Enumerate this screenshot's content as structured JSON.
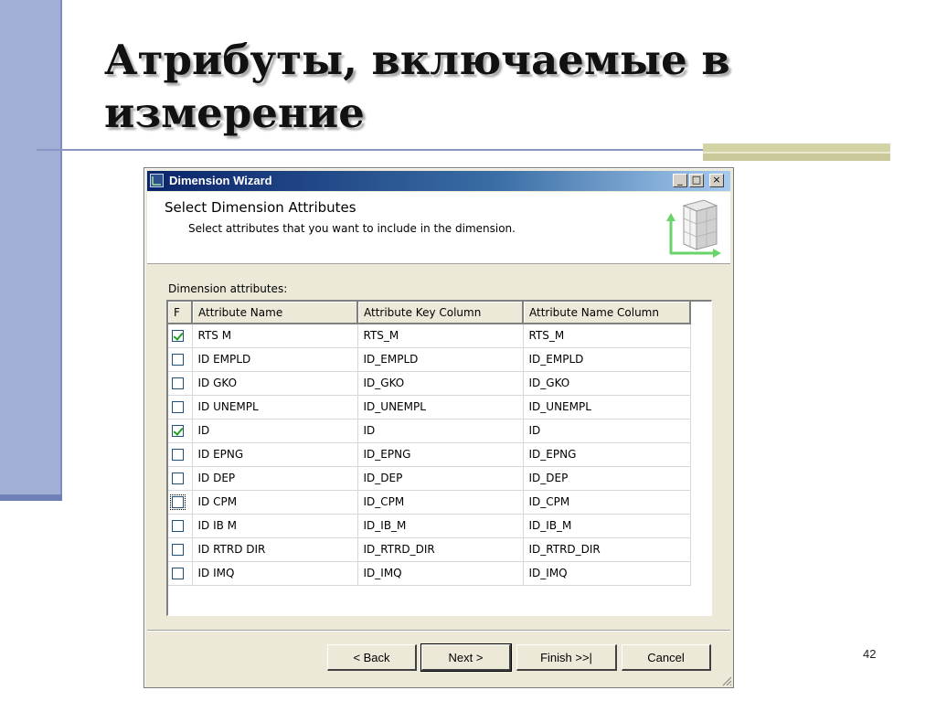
{
  "slide": {
    "title_line1": "Атрибуты, включаемые в",
    "title_line2": "измерение",
    "page_number": "42"
  },
  "window": {
    "title": "Dimension Wizard",
    "controls": {
      "minimize": "_",
      "maximize": "□",
      "close": "×"
    }
  },
  "header": {
    "title": "Select Dimension Attributes",
    "subtitle": "Select attributes that you want to include in the dimension."
  },
  "grid": {
    "label": "Dimension attributes:",
    "check_header": "F",
    "columns": [
      "Attribute Name",
      "Attribute Key Column",
      "Attribute Name Column"
    ],
    "rows": [
      {
        "checked": true,
        "name": "RTS M",
        "key": "RTS_M",
        "name_col": "RTS_M"
      },
      {
        "checked": false,
        "name": "ID EMPLD",
        "key": "ID_EMPLD",
        "name_col": "ID_EMPLD"
      },
      {
        "checked": false,
        "name": "ID GKO",
        "key": "ID_GKO",
        "name_col": "ID_GKO"
      },
      {
        "checked": false,
        "name": "ID UNEMPL",
        "key": "ID_UNEMPL",
        "name_col": "ID_UNEMPL"
      },
      {
        "checked": true,
        "name": "ID",
        "key": "ID",
        "name_col": "ID"
      },
      {
        "checked": false,
        "name": "ID EPNG",
        "key": "ID_EPNG",
        "name_col": "ID_EPNG"
      },
      {
        "checked": false,
        "name": "ID DEP",
        "key": "ID_DEP",
        "name_col": "ID_DEP"
      },
      {
        "checked": false,
        "name": "ID CPM",
        "key": "ID_CPM",
        "name_col": "ID_CPM",
        "focused": true
      },
      {
        "checked": false,
        "name": "ID IB M",
        "key": "ID_IB_M",
        "name_col": "ID_IB_M"
      },
      {
        "checked": false,
        "name": "ID RTRD DIR",
        "key": "ID_RTRD_DIR",
        "name_col": "ID_RTRD_DIR"
      },
      {
        "checked": false,
        "name": "ID IMQ",
        "key": "ID_IMQ",
        "name_col": "ID_IMQ"
      }
    ]
  },
  "buttons": {
    "back": "< Back",
    "next": "Next >",
    "finish": "Finish >>|",
    "cancel": "Cancel"
  },
  "colors": {
    "slide_left_bar": "#a3aed6",
    "titlebar_start": "#0a246a",
    "titlebar_end": "#a6caf0",
    "dialog_face": "#ece9d8",
    "check_mark": "#21a121"
  }
}
